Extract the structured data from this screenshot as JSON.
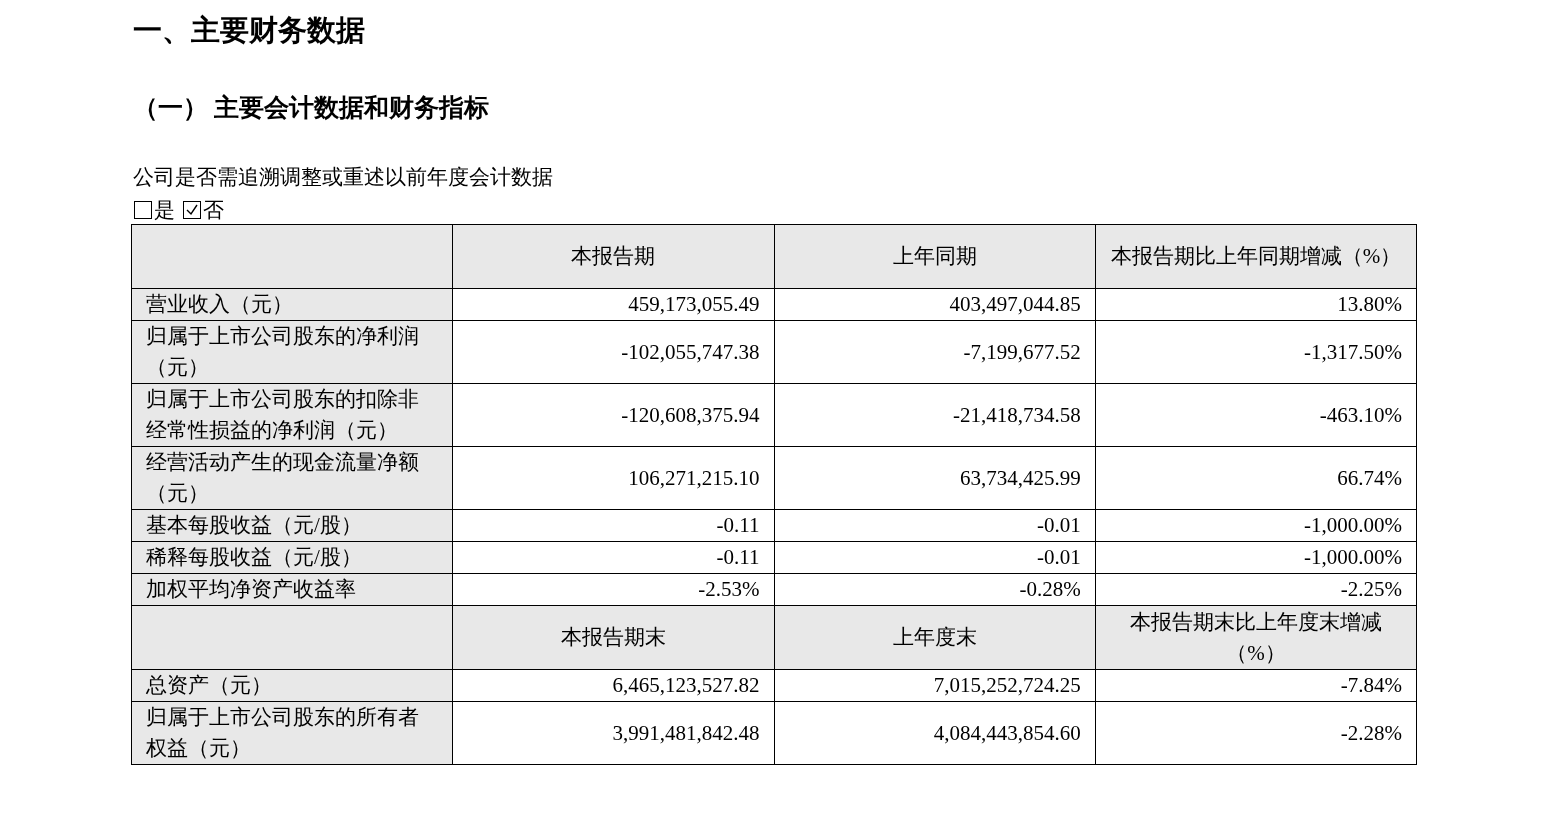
{
  "title": "一、主要财务数据",
  "subtitle": "（一） 主要会计数据和财务指标",
  "question": "公司是否需追溯调整或重述以前年度会计数据",
  "options": [
    {
      "label": "是",
      "checked": false
    },
    {
      "label": "否",
      "checked": true
    }
  ],
  "table": {
    "sections": [
      {
        "columns": [
          "本报告期",
          "上年同期",
          "本报告期比上年同期增减（%）"
        ],
        "rows": [
          {
            "label": "营业收入（元）",
            "values": [
              "459,173,055.49",
              "403,497,044.85",
              "13.80%"
            ]
          },
          {
            "label": "归属于上市公司股东的净利润（元）",
            "values": [
              "-102,055,747.38",
              "-7,199,677.52",
              "-1,317.50%"
            ]
          },
          {
            "label": "归属于上市公司股东的扣除非经常性损益的净利润（元）",
            "values": [
              "-120,608,375.94",
              "-21,418,734.58",
              "-463.10%"
            ]
          },
          {
            "label": "经营活动产生的现金流量净额（元）",
            "values": [
              "106,271,215.10",
              "63,734,425.99",
              "66.74%"
            ]
          },
          {
            "label": "基本每股收益（元/股）",
            "values": [
              "-0.11",
              "-0.01",
              "-1,000.00%"
            ]
          },
          {
            "label": "稀释每股收益（元/股）",
            "values": [
              "-0.11",
              "-0.01",
              "-1,000.00%"
            ]
          },
          {
            "label": "加权平均净资产收益率",
            "values": [
              "-2.53%",
              "-0.28%",
              "-2.25%"
            ]
          }
        ]
      },
      {
        "columns": [
          "本报告期末",
          "上年度末",
          "本报告期末比上年度末增减（%）"
        ],
        "rows": [
          {
            "label": "总资产（元）",
            "values": [
              "6,465,123,527.82",
              "7,015,252,724.25",
              "-7.84%"
            ]
          },
          {
            "label": "归属于上市公司股东的所有者权益（元）",
            "values": [
              "3,991,481,842.48",
              "4,084,443,854.60",
              "-2.28%"
            ]
          }
        ]
      }
    ]
  }
}
